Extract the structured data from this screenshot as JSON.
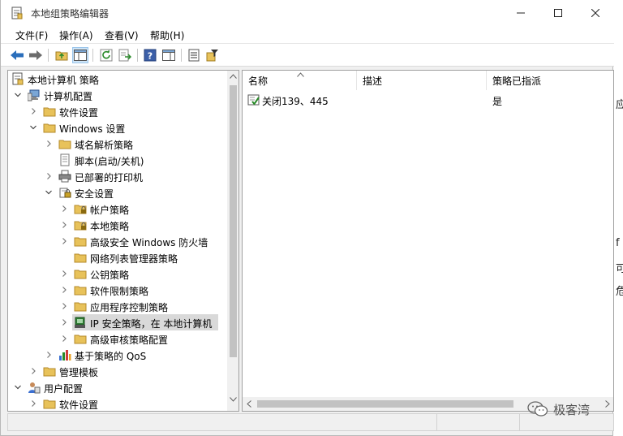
{
  "window": {
    "title": "本地组策略编辑器"
  },
  "menu": [
    "文件(F)",
    "操作(A)",
    "查看(V)",
    "帮助(H)"
  ],
  "toolbar": {
    "icons": [
      "back-icon",
      "forward-icon",
      "up-folder-icon",
      "show-hide-tree-icon",
      "refresh-icon",
      "export-list-icon",
      "help-icon",
      "console-view-icon",
      "properties-icon",
      "filter-icon"
    ]
  },
  "tree": [
    {
      "label": "本地计算机 策略",
      "depth": 0,
      "expander": "none",
      "icon": "policy-root-icon"
    },
    {
      "label": "计算机配置",
      "depth": 1,
      "expander": "expanded",
      "icon": "computer-icon"
    },
    {
      "label": "软件设置",
      "depth": 2,
      "expander": "collapsed",
      "icon": "folder-icon"
    },
    {
      "label": "Windows 设置",
      "depth": 2,
      "expander": "expanded",
      "icon": "folder-icon"
    },
    {
      "label": "域名解析策略",
      "depth": 3,
      "expander": "collapsed",
      "icon": "folder-icon"
    },
    {
      "label": "脚本(启动/关机)",
      "depth": 3,
      "expander": "none",
      "icon": "script-icon"
    },
    {
      "label": "已部署的打印机",
      "depth": 3,
      "expander": "collapsed",
      "icon": "printer-icon"
    },
    {
      "label": "安全设置",
      "depth": 3,
      "expander": "expanded",
      "icon": "security-icon"
    },
    {
      "label": "帐户策略",
      "depth": 4,
      "expander": "collapsed",
      "icon": "locked-folder-icon"
    },
    {
      "label": "本地策略",
      "depth": 4,
      "expander": "collapsed",
      "icon": "locked-folder-icon"
    },
    {
      "label": "高级安全 Windows 防火墙",
      "depth": 4,
      "expander": "collapsed",
      "icon": "folder-icon"
    },
    {
      "label": "网络列表管理器策略",
      "depth": 4,
      "expander": "none",
      "icon": "folder-icon"
    },
    {
      "label": "公钥策略",
      "depth": 4,
      "expander": "collapsed",
      "icon": "folder-icon"
    },
    {
      "label": "软件限制策略",
      "depth": 4,
      "expander": "collapsed",
      "icon": "folder-icon"
    },
    {
      "label": "应用程序控制策略",
      "depth": 4,
      "expander": "collapsed",
      "icon": "folder-icon"
    },
    {
      "label": "IP 安全策略，在 本地计算机",
      "depth": 4,
      "expander": "collapsed",
      "icon": "ip-security-icon",
      "selected": true
    },
    {
      "label": "高级审核策略配置",
      "depth": 4,
      "expander": "collapsed",
      "icon": "folder-icon"
    },
    {
      "label": "基于策略的 QoS",
      "depth": 3,
      "expander": "collapsed",
      "icon": "qos-chart-icon"
    },
    {
      "label": "管理模板",
      "depth": 2,
      "expander": "collapsed",
      "icon": "folder-icon"
    },
    {
      "label": "用户配置",
      "depth": 1,
      "expander": "expanded",
      "icon": "user-icon"
    },
    {
      "label": "软件设置",
      "depth": 2,
      "expander": "collapsed",
      "icon": "folder-icon"
    }
  ],
  "list": {
    "columns": [
      "名称",
      "描述",
      "策略已指派"
    ],
    "rows": [
      {
        "name": "关闭139、445",
        "description": "",
        "assigned": "是"
      }
    ]
  },
  "background_peek": [
    "应",
    "f",
    "可",
    "危"
  ],
  "watermark": "极客湾",
  "colors": {
    "folder": "#e8c25a",
    "selection": "#d9d9d9",
    "accent_blue": "#2a6ebb"
  }
}
